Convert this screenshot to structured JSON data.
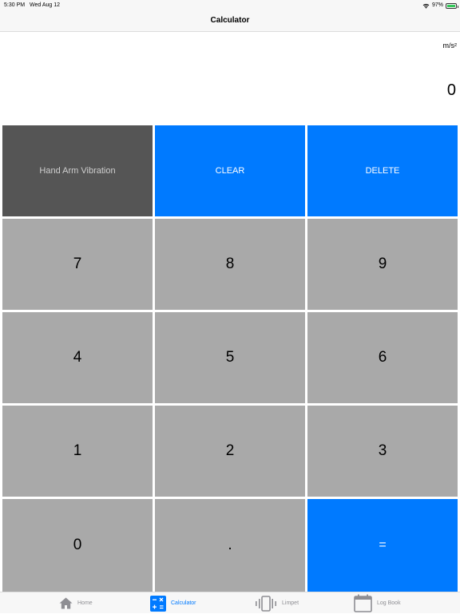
{
  "status_bar": {
    "time": "5:30 PM",
    "date": "Wed Aug 12",
    "battery": "97%",
    "wifi_icon": "wifi-icon",
    "battery_icon": "battery-charging-icon"
  },
  "nav": {
    "title": "Calculator"
  },
  "display": {
    "unit": "m/s²",
    "value": "0"
  },
  "keypad": {
    "mode": "Hand Arm Vibration",
    "clear": "CLEAR",
    "delete": "DELETE",
    "digits": [
      "7",
      "8",
      "9",
      "4",
      "5",
      "6",
      "1",
      "2",
      "3",
      "0"
    ],
    "decimal": ".",
    "equals": "="
  },
  "tabs": [
    {
      "label": "Home",
      "icon": "home-icon"
    },
    {
      "label": "Calculator",
      "icon": "calculator-icon"
    },
    {
      "label": "Limpet",
      "icon": "vibration-icon"
    },
    {
      "label": "Log Book",
      "icon": "calendar-icon"
    }
  ],
  "colors": {
    "accent": "#007aff",
    "key_gray": "#a9a9a9",
    "key_dark": "#555555",
    "battery": "#33c759"
  }
}
